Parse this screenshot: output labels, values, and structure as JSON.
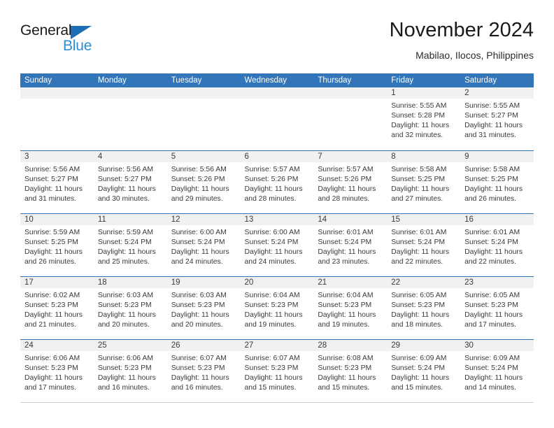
{
  "brand": {
    "word_one": "General",
    "word_two": "Blue",
    "triangle_icon": "triangle-icon",
    "accent_dark": "#1c6fb5",
    "accent_light": "#2a8fd4"
  },
  "header": {
    "title": "November 2024",
    "subtitle": "Mabilao, Ilocos, Philippines"
  },
  "theme": {
    "header_blue": "#3275b8",
    "day_band_gray": "#f1f1f1",
    "text": "#3a3a3a"
  },
  "weekday_headers": [
    "Sunday",
    "Monday",
    "Tuesday",
    "Wednesday",
    "Thursday",
    "Friday",
    "Saturday"
  ],
  "weeks": [
    [
      {
        "day": "",
        "sunrise": "",
        "sunset": "",
        "daylight_line1": "",
        "daylight_line2": "",
        "empty": true
      },
      {
        "day": "",
        "sunrise": "",
        "sunset": "",
        "daylight_line1": "",
        "daylight_line2": "",
        "empty": true
      },
      {
        "day": "",
        "sunrise": "",
        "sunset": "",
        "daylight_line1": "",
        "daylight_line2": "",
        "empty": true
      },
      {
        "day": "",
        "sunrise": "",
        "sunset": "",
        "daylight_line1": "",
        "daylight_line2": "",
        "empty": true
      },
      {
        "day": "",
        "sunrise": "",
        "sunset": "",
        "daylight_line1": "",
        "daylight_line2": "",
        "empty": true
      },
      {
        "day": "1",
        "sunrise": "Sunrise: 5:55 AM",
        "sunset": "Sunset: 5:28 PM",
        "daylight_line1": "Daylight: 11 hours",
        "daylight_line2": "and 32 minutes."
      },
      {
        "day": "2",
        "sunrise": "Sunrise: 5:55 AM",
        "sunset": "Sunset: 5:27 PM",
        "daylight_line1": "Daylight: 11 hours",
        "daylight_line2": "and 31 minutes."
      }
    ],
    [
      {
        "day": "3",
        "sunrise": "Sunrise: 5:56 AM",
        "sunset": "Sunset: 5:27 PM",
        "daylight_line1": "Daylight: 11 hours",
        "daylight_line2": "and 31 minutes."
      },
      {
        "day": "4",
        "sunrise": "Sunrise: 5:56 AM",
        "sunset": "Sunset: 5:27 PM",
        "daylight_line1": "Daylight: 11 hours",
        "daylight_line2": "and 30 minutes."
      },
      {
        "day": "5",
        "sunrise": "Sunrise: 5:56 AM",
        "sunset": "Sunset: 5:26 PM",
        "daylight_line1": "Daylight: 11 hours",
        "daylight_line2": "and 29 minutes."
      },
      {
        "day": "6",
        "sunrise": "Sunrise: 5:57 AM",
        "sunset": "Sunset: 5:26 PM",
        "daylight_line1": "Daylight: 11 hours",
        "daylight_line2": "and 28 minutes."
      },
      {
        "day": "7",
        "sunrise": "Sunrise: 5:57 AM",
        "sunset": "Sunset: 5:26 PM",
        "daylight_line1": "Daylight: 11 hours",
        "daylight_line2": "and 28 minutes."
      },
      {
        "day": "8",
        "sunrise": "Sunrise: 5:58 AM",
        "sunset": "Sunset: 5:25 PM",
        "daylight_line1": "Daylight: 11 hours",
        "daylight_line2": "and 27 minutes."
      },
      {
        "day": "9",
        "sunrise": "Sunrise: 5:58 AM",
        "sunset": "Sunset: 5:25 PM",
        "daylight_line1": "Daylight: 11 hours",
        "daylight_line2": "and 26 minutes."
      }
    ],
    [
      {
        "day": "10",
        "sunrise": "Sunrise: 5:59 AM",
        "sunset": "Sunset: 5:25 PM",
        "daylight_line1": "Daylight: 11 hours",
        "daylight_line2": "and 26 minutes."
      },
      {
        "day": "11",
        "sunrise": "Sunrise: 5:59 AM",
        "sunset": "Sunset: 5:24 PM",
        "daylight_line1": "Daylight: 11 hours",
        "daylight_line2": "and 25 minutes."
      },
      {
        "day": "12",
        "sunrise": "Sunrise: 6:00 AM",
        "sunset": "Sunset: 5:24 PM",
        "daylight_line1": "Daylight: 11 hours",
        "daylight_line2": "and 24 minutes."
      },
      {
        "day": "13",
        "sunrise": "Sunrise: 6:00 AM",
        "sunset": "Sunset: 5:24 PM",
        "daylight_line1": "Daylight: 11 hours",
        "daylight_line2": "and 24 minutes."
      },
      {
        "day": "14",
        "sunrise": "Sunrise: 6:01 AM",
        "sunset": "Sunset: 5:24 PM",
        "daylight_line1": "Daylight: 11 hours",
        "daylight_line2": "and 23 minutes."
      },
      {
        "day": "15",
        "sunrise": "Sunrise: 6:01 AM",
        "sunset": "Sunset: 5:24 PM",
        "daylight_line1": "Daylight: 11 hours",
        "daylight_line2": "and 22 minutes."
      },
      {
        "day": "16",
        "sunrise": "Sunrise: 6:01 AM",
        "sunset": "Sunset: 5:24 PM",
        "daylight_line1": "Daylight: 11 hours",
        "daylight_line2": "and 22 minutes."
      }
    ],
    [
      {
        "day": "17",
        "sunrise": "Sunrise: 6:02 AM",
        "sunset": "Sunset: 5:23 PM",
        "daylight_line1": "Daylight: 11 hours",
        "daylight_line2": "and 21 minutes."
      },
      {
        "day": "18",
        "sunrise": "Sunrise: 6:03 AM",
        "sunset": "Sunset: 5:23 PM",
        "daylight_line1": "Daylight: 11 hours",
        "daylight_line2": "and 20 minutes."
      },
      {
        "day": "19",
        "sunrise": "Sunrise: 6:03 AM",
        "sunset": "Sunset: 5:23 PM",
        "daylight_line1": "Daylight: 11 hours",
        "daylight_line2": "and 20 minutes."
      },
      {
        "day": "20",
        "sunrise": "Sunrise: 6:04 AM",
        "sunset": "Sunset: 5:23 PM",
        "daylight_line1": "Daylight: 11 hours",
        "daylight_line2": "and 19 minutes."
      },
      {
        "day": "21",
        "sunrise": "Sunrise: 6:04 AM",
        "sunset": "Sunset: 5:23 PM",
        "daylight_line1": "Daylight: 11 hours",
        "daylight_line2": "and 19 minutes."
      },
      {
        "day": "22",
        "sunrise": "Sunrise: 6:05 AM",
        "sunset": "Sunset: 5:23 PM",
        "daylight_line1": "Daylight: 11 hours",
        "daylight_line2": "and 18 minutes."
      },
      {
        "day": "23",
        "sunrise": "Sunrise: 6:05 AM",
        "sunset": "Sunset: 5:23 PM",
        "daylight_line1": "Daylight: 11 hours",
        "daylight_line2": "and 17 minutes."
      }
    ],
    [
      {
        "day": "24",
        "sunrise": "Sunrise: 6:06 AM",
        "sunset": "Sunset: 5:23 PM",
        "daylight_line1": "Daylight: 11 hours",
        "daylight_line2": "and 17 minutes."
      },
      {
        "day": "25",
        "sunrise": "Sunrise: 6:06 AM",
        "sunset": "Sunset: 5:23 PM",
        "daylight_line1": "Daylight: 11 hours",
        "daylight_line2": "and 16 minutes."
      },
      {
        "day": "26",
        "sunrise": "Sunrise: 6:07 AM",
        "sunset": "Sunset: 5:23 PM",
        "daylight_line1": "Daylight: 11 hours",
        "daylight_line2": "and 16 minutes."
      },
      {
        "day": "27",
        "sunrise": "Sunrise: 6:07 AM",
        "sunset": "Sunset: 5:23 PM",
        "daylight_line1": "Daylight: 11 hours",
        "daylight_line2": "and 15 minutes."
      },
      {
        "day": "28",
        "sunrise": "Sunrise: 6:08 AM",
        "sunset": "Sunset: 5:23 PM",
        "daylight_line1": "Daylight: 11 hours",
        "daylight_line2": "and 15 minutes."
      },
      {
        "day": "29",
        "sunrise": "Sunrise: 6:09 AM",
        "sunset": "Sunset: 5:24 PM",
        "daylight_line1": "Daylight: 11 hours",
        "daylight_line2": "and 15 minutes."
      },
      {
        "day": "30",
        "sunrise": "Sunrise: 6:09 AM",
        "sunset": "Sunset: 5:24 PM",
        "daylight_line1": "Daylight: 11 hours",
        "daylight_line2": "and 14 minutes."
      }
    ]
  ]
}
